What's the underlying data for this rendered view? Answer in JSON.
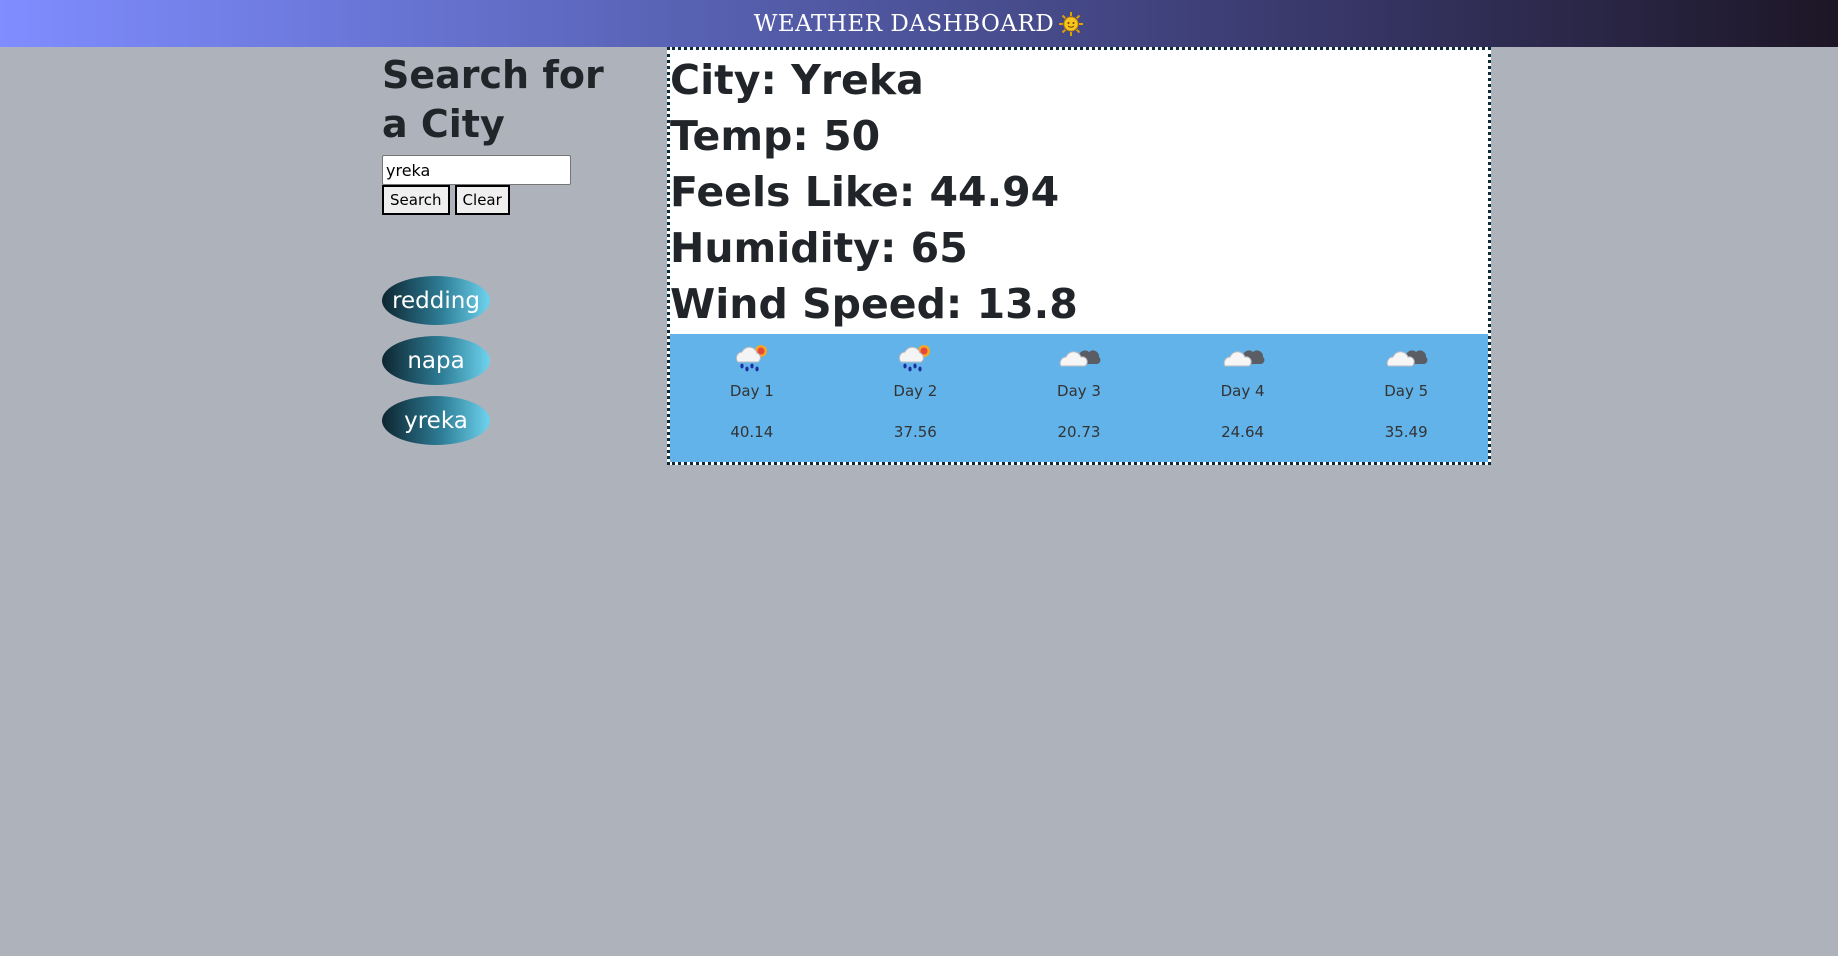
{
  "header": {
    "title": "WEATHER DASHBOARD",
    "icon": "sun-icon"
  },
  "sidebar": {
    "heading": "Search for a City",
    "search_value": "yreka",
    "search_label": "Search",
    "clear_label": "Clear",
    "history": [
      "redding",
      "napa",
      "yreka"
    ]
  },
  "current": {
    "city": "City: Yreka",
    "temp": "Temp: 50",
    "feels_like": "Feels Like: 44.94",
    "humidity": "Humidity: 65",
    "wind_speed": "Wind Speed: 13.8"
  },
  "forecast": [
    {
      "label": "Day 1",
      "temp": "40.14",
      "icon": "rain-sun-icon"
    },
    {
      "label": "Day 2",
      "temp": "37.56",
      "icon": "rain-sun-icon"
    },
    {
      "label": "Day 3",
      "temp": "20.73",
      "icon": "cloud-icon"
    },
    {
      "label": "Day 4",
      "temp": "24.64",
      "icon": "cloud-icon"
    },
    {
      "label": "Day 5",
      "temp": "35.49",
      "icon": "cloud-icon"
    }
  ],
  "colors": {
    "background": "#aeb2bb",
    "forecast_bg": "#62b3ea",
    "header_start": "#7f8dff",
    "header_end": "#1d1626"
  }
}
